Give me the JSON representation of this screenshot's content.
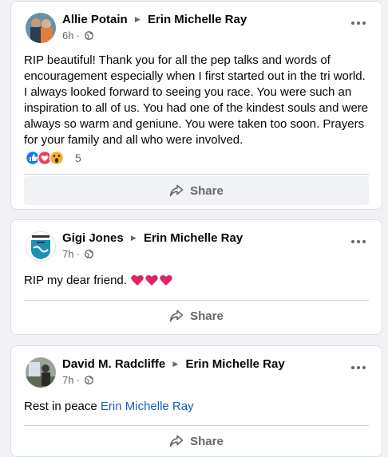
{
  "posts": [
    {
      "author": "Allie Potain",
      "target": "Erin Michelle Ray",
      "time": "6h",
      "dot": "·",
      "text": "RIP beautiful! Thank you for all the pep talks and words of encouragement especially when I first started out in the tri world. I always looked forward to seeing you race. You were such an inspiration to all of us. You had one of the kindest souls and were always so warm and geniune. You were taken too soon. Prayers for your family and all who were involved.",
      "reactions": [
        "like-icon",
        "love-icon",
        "wow-icon"
      ],
      "reaction_count": "5",
      "share_label": "Share"
    },
    {
      "author": "Gigi Jones",
      "target": "Erin Michelle Ray",
      "time": "7h",
      "dot": "·",
      "text": "RIP my dear friend.",
      "emoji": [
        "heart-icon",
        "heart-icon",
        "heart-icon"
      ],
      "share_label": "Share"
    },
    {
      "author": "David M. Radcliffe",
      "target": "Erin Michelle Ray",
      "time": "7h",
      "dot": "·",
      "text": "Rest in peace",
      "mention": "Erin Michelle Ray",
      "share_label": "Share"
    }
  ],
  "colors": {
    "link": "#1a5fb4",
    "like": "#1877f2",
    "love": "#f33e58",
    "wow": "#f7b125",
    "heart": "#e0245e"
  }
}
